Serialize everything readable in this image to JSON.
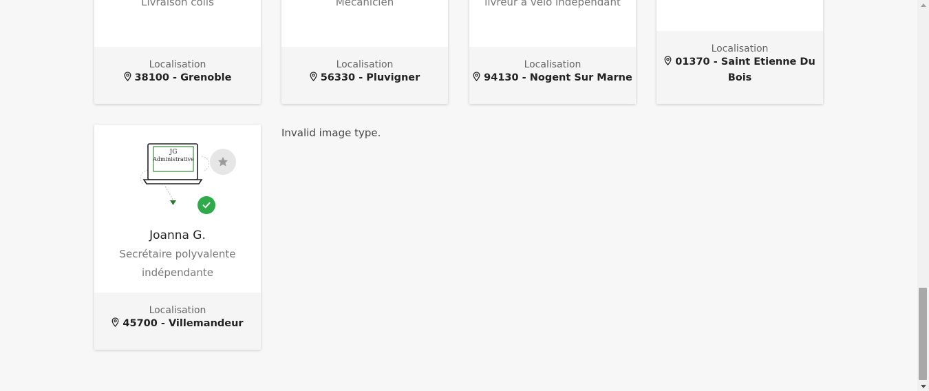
{
  "cards_top": [
    {
      "job": "Livraison colis",
      "location_label": "Localisation",
      "location": "38100 - Grenoble"
    },
    {
      "job": "Mécanicien",
      "location_label": "Localisation",
      "location": "56330 - Pluvigner"
    },
    {
      "job": "livreur à vélo indépendant",
      "location_label": "Localisation",
      "location": "94130 - Nogent Sur Marne"
    },
    {
      "job": "",
      "location_label": "Localisation",
      "location_line1": "01370 - Saint Etienne Du",
      "location_line2": "Bois"
    }
  ],
  "featured_card": {
    "logo_text_line1": "JG",
    "logo_text_line2": "Administrative",
    "name": "Joanna G.",
    "job_line1": "Secrétaire polyvalente",
    "job_line2": "indépendante",
    "location_label": "Localisation",
    "location": "45700 - Villemandeur",
    "favorite_icon": "star-icon",
    "verified_icon": "check-icon"
  },
  "invalid_image_message": "Invalid image type.",
  "colors": {
    "verified_green": "#2eaa4a",
    "logo_green": "#3a8a3a",
    "background": "#f7f7f7"
  }
}
